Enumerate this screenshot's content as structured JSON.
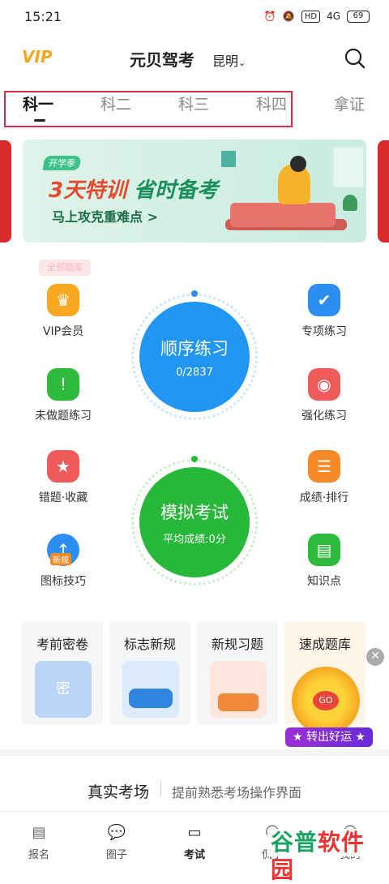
{
  "status": {
    "time": "15:21",
    "hd": "HD",
    "network": "4G",
    "battery": "69"
  },
  "header": {
    "vip": "VIP",
    "title": "元贝驾考",
    "city": "昆明"
  },
  "tabs": [
    {
      "label": "科一",
      "active": true
    },
    {
      "label": "科二"
    },
    {
      "label": "科三"
    },
    {
      "label": "科四"
    },
    {
      "label": "拿证"
    }
  ],
  "banner": {
    "tag": "开学季",
    "highlight": "3天特训",
    "headline": " 省时备考",
    "sub": "马上攻克重难点 >"
  },
  "vip_hint": "全部题库",
  "left_items": [
    {
      "label": "VIP会员",
      "icon": "crown-icon",
      "color": "#f7a81e"
    },
    {
      "label": "未做题练习",
      "icon": "exclamation-icon",
      "color": "#2dbb3b"
    },
    {
      "label": "错题·收藏",
      "icon": "star-icon",
      "color": "#ef5a5a"
    },
    {
      "label": "图标技巧",
      "icon": "upload-icon",
      "color": "#2b8ef0",
      "badge": "新规"
    }
  ],
  "right_items": [
    {
      "label": "专项练习",
      "icon": "clipboard-icon",
      "color": "#2b8ef0"
    },
    {
      "label": "强化练习",
      "icon": "target-icon",
      "color": "#ef5a5a"
    },
    {
      "label": "成绩·排行",
      "icon": "list-icon",
      "color": "#f78a28"
    },
    {
      "label": "知识点",
      "icon": "book-icon",
      "color": "#2dbb3b"
    }
  ],
  "practice": {
    "title": "顺序练习",
    "progress": "0/2837"
  },
  "exam": {
    "title": "模拟考试",
    "avg": "平均成绩:0分"
  },
  "cards": [
    {
      "title": "考前密卷",
      "art": "envelope-icon",
      "art_text": "密"
    },
    {
      "title": "标志新规",
      "art": "car-icon"
    },
    {
      "title": "新规习题",
      "art": "book-stack-icon"
    },
    {
      "title": "速成题库",
      "art": "wheel-icon",
      "art_text": "GO"
    }
  ],
  "luck_label": "★ 转出好运 ★",
  "real_exam": {
    "title": "真实考场",
    "sub": "提前熟悉考场操作界面"
  },
  "nav": [
    {
      "label": "报名",
      "icon": "document-icon"
    },
    {
      "label": "圈子",
      "icon": "chat-icon"
    },
    {
      "label": "考试",
      "icon": "wallet-icon",
      "active": true
    },
    {
      "label": "侃学",
      "icon": "tutor-icon"
    },
    {
      "label": "我的",
      "icon": "user-icon"
    }
  ],
  "watermark": {
    "a": "谷普",
    "b": "软件园"
  }
}
